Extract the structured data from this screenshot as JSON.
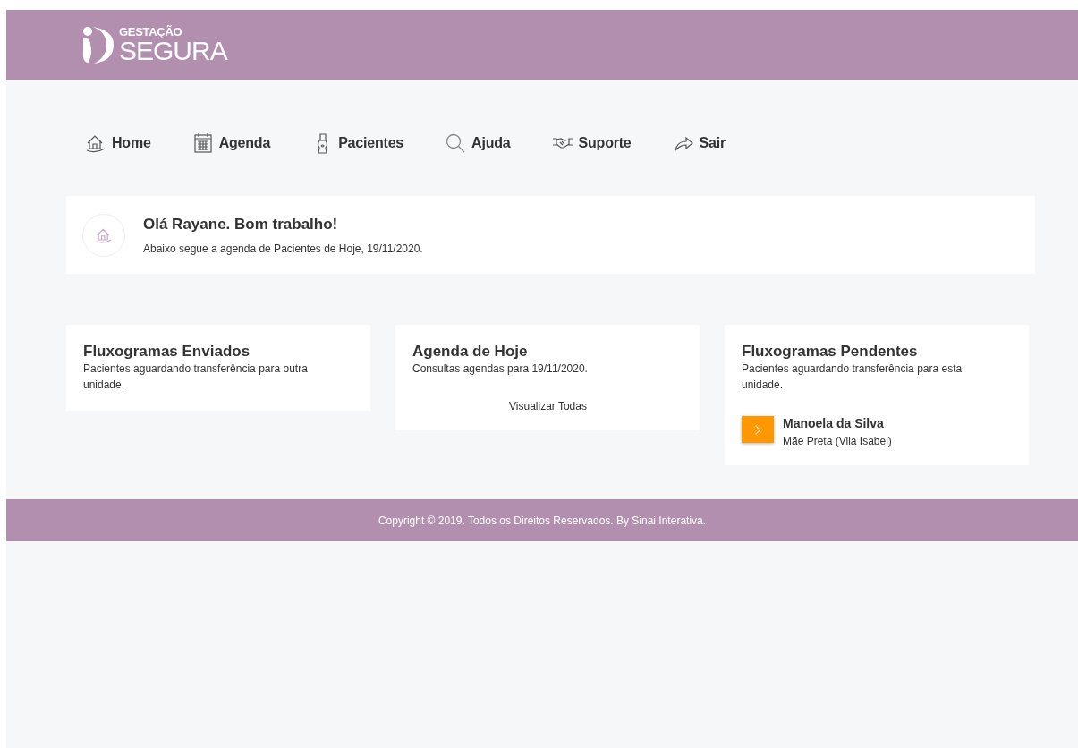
{
  "header": {
    "logo": {
      "top": "GESTAÇÃO",
      "bottom": "SEGURA"
    }
  },
  "nav": [
    "Home",
    "Agenda",
    "Pacientes",
    "Ajuda",
    "Suporte",
    "Sair"
  ],
  "welcome": {
    "title": "Olá Rayane. Bom trabalho!",
    "text": "Abaixo segue a agenda de Pacientes de Hoje, 19/11/2020."
  },
  "cards": [
    {
      "title": "Fluxogramas Enviados",
      "subtitle": "Pacientes aguardando transferência para outra unidade."
    },
    {
      "title": "Agenda de Hoje",
      "subtitle": "Consultas agendas para 19/11/2020.",
      "link": "Visualizar Todas"
    },
    {
      "title": "Fluxogramas Pendentes",
      "subtitle": "Pacientes aguardando transferência para esta unidade.",
      "items": [
        {
          "name": "Manoela da Silva",
          "place": "Mãe Preta (Vila Isabel)"
        }
      ]
    }
  ],
  "footer": "Copyright © 2019. Todos os Direitos Reservados. By Sinai Interativa."
}
